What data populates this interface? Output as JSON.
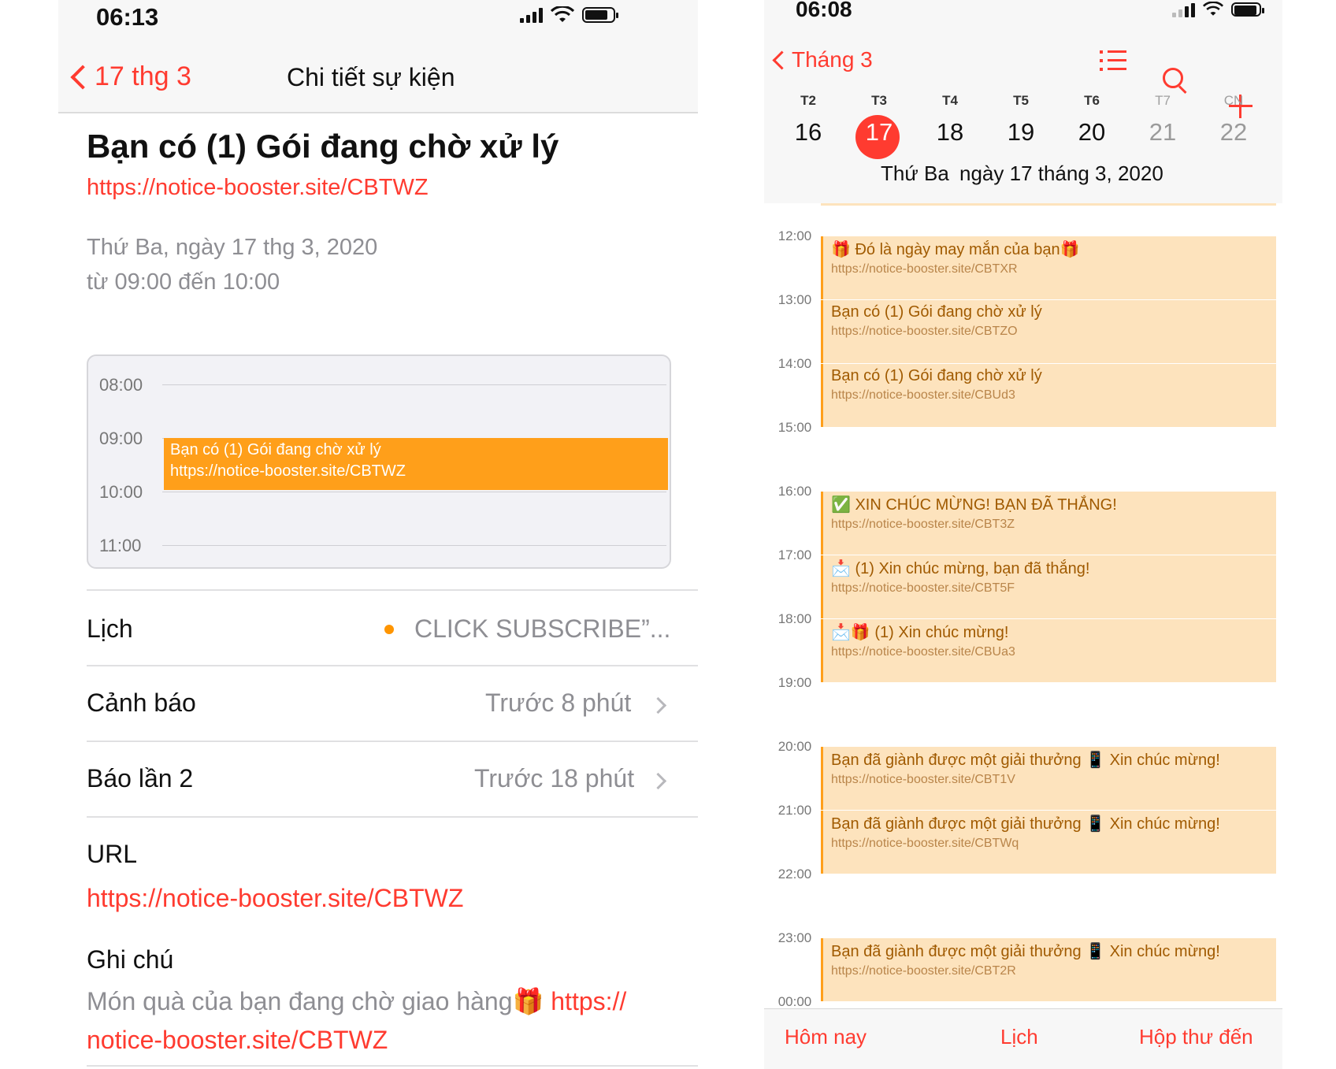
{
  "left": {
    "status_time": "06:13",
    "back_label": "17 thg 3",
    "nav_title": "Chi tiết sự kiện",
    "event_title": "Bạn có (1) Gói đang chờ xử lý",
    "event_url": "https://notice-booster.site/CBTWZ",
    "event_date": "Thứ Ba, ngày 17 thg 3, 2020",
    "event_time": "từ 09:00 đến 10:00",
    "mini_calendar": {
      "hours": [
        "08:00",
        "09:00",
        "10:00",
        "11:00"
      ],
      "event_title": "Bạn có (1) Gói đang chờ xử lý",
      "event_url": "https://notice-booster.site/CBTWZ"
    },
    "rows": {
      "calendar_label": "Lịch",
      "calendar_value": "CLICK SUBSCRIBE”...",
      "alert_label": "Cảnh báo",
      "alert_value": "Trước 8 phút",
      "alert2_label": "Báo lần 2",
      "alert2_value": "Trước 18 phút",
      "url_label": "URL",
      "url_value": "https://notice-booster.site/CBTWZ",
      "notes_label": "Ghi chú",
      "notes_text": "Món quà của bạn đang chờ giao hàng🎁",
      "notes_link_1": "https://",
      "notes_link_2": "notice-booster.site/CBTWZ"
    }
  },
  "right": {
    "status_time": "06:08",
    "back_label": "Tháng 3",
    "weekdays": [
      "T2",
      "T3",
      "T4",
      "T5",
      "T6",
      "T7",
      "CN"
    ],
    "days": [
      "16",
      "17",
      "18",
      "19",
      "20",
      "21",
      "22"
    ],
    "date_line_day": "Thứ Ba",
    "date_line_date": "ngày 17 tháng 3, 2020",
    "hours": [
      "12:00",
      "13:00",
      "14:00",
      "15:00",
      "16:00",
      "17:00",
      "18:00",
      "19:00",
      "20:00",
      "21:00",
      "22:00",
      "23:00",
      "00:00"
    ],
    "events": [
      {
        "title": "🎁 Đó là ngày may mắn của bạn🎁",
        "url": "https://notice-booster.site/CBTXR"
      },
      {
        "title": "Bạn có (1) Gói đang chờ xử lý",
        "url": "https://notice-booster.site/CBTZO"
      },
      {
        "title": "Bạn có (1) Gói đang chờ xử lý",
        "url": "https://notice-booster.site/CBUd3"
      },
      {
        "title": "✅ XIN CHÚC MỪNG! BẠN ĐÃ THẮNG!",
        "url": "https://notice-booster.site/CBT3Z"
      },
      {
        "title": "📩 (1) Xin chúc mừng, bạn đã thắng!",
        "url": "https://notice-booster.site/CBT5F"
      },
      {
        "title": "📩🎁 (1) Xin chúc mừng!",
        "url": "https://notice-booster.site/CBUa3"
      },
      {
        "title": "Bạn đã giành được một giải thưởng 📱 Xin chúc mừng!",
        "url": "https://notice-booster.site/CBT1V"
      },
      {
        "title": "Bạn đã giành được một giải thưởng 📱 Xin chúc mừng!",
        "url": "https://notice-booster.site/CBTWq"
      },
      {
        "title": "Bạn đã giành được một giải thưởng 📱 Xin chúc mừng!",
        "url": "https://notice-booster.site/CBT2R"
      }
    ],
    "tabs": [
      "Hôm nay",
      "Lịch",
      "Hộp thư đến"
    ]
  },
  "colors": {
    "accent": "#ff3b30",
    "event_bg": "#fde3bd",
    "event_orange": "#ff9f1a"
  }
}
